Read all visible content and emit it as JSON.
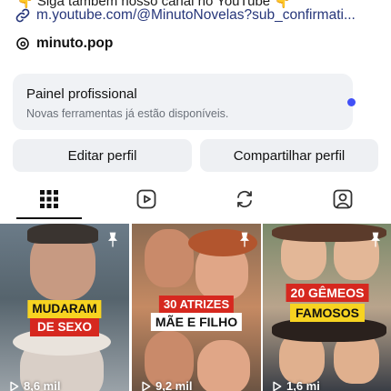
{
  "bio": {
    "top_line": "👇 Siga também nosso canal no YouTube 👇",
    "link": "m.youtube.com/@MinutoNovelas?sub_confirmati...",
    "threads_handle": "minuto.pop"
  },
  "panel": {
    "title": "Painel profissional",
    "subtitle": "Novas ferramentas já estão disponíveis."
  },
  "buttons": {
    "edit": "Editar perfil",
    "share": "Compartilhar perfil"
  },
  "tabs": [
    {
      "icon": "grid-icon",
      "active": true
    },
    {
      "icon": "reels-icon",
      "active": false
    },
    {
      "icon": "reposts-icon",
      "active": false
    },
    {
      "icon": "tagged-icon",
      "active": false
    }
  ],
  "posts": [
    {
      "line1": "MUDARAM",
      "line2": "DE SEXO",
      "views": "8,6 mil",
      "pinned": true
    },
    {
      "line1": "30 ATRIZES",
      "line2": "MÃE E FILHO",
      "views": "9,2 mil",
      "pinned": true
    },
    {
      "line1": "20 GÊMEOS",
      "line2": "FAMOSOS",
      "views": "1,6 mi",
      "pinned": true
    }
  ],
  "colors": {
    "accent_dot": "#4150f7",
    "link": "#26367a",
    "button_bg": "#eef0f3",
    "badge_yellow": "#f7d321",
    "badge_red": "#d6281f"
  }
}
